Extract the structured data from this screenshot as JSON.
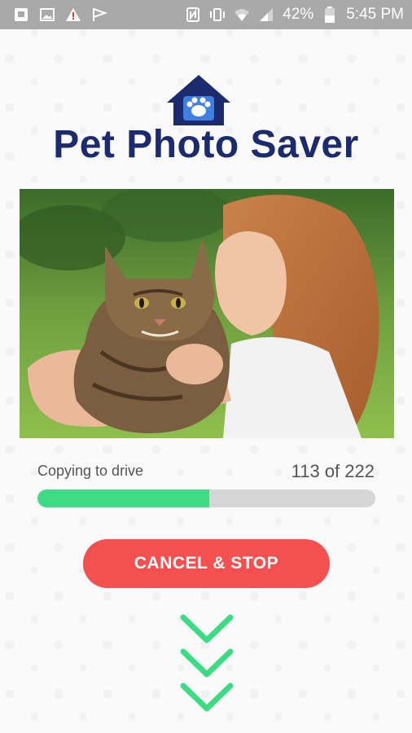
{
  "status_bar": {
    "battery": "42%",
    "time": "5:45 PM",
    "left_icons": [
      "photo-icon",
      "image-icon",
      "alert-icon",
      "flag-icon"
    ],
    "right_icons": [
      "nfc-icon",
      "vibrate-icon",
      "wifi-icon",
      "signal-icon",
      "battery-icon"
    ]
  },
  "app": {
    "title": "Pet Photo Saver",
    "logo_icon": "house-paw-icon",
    "brand_color": "#1c2a6e"
  },
  "photo": {
    "subject": "woman kissing tabby cat"
  },
  "progress": {
    "label": "Copying to drive",
    "count_text": "113 of 222",
    "current": 113,
    "total": 222,
    "fill_color": "#3ddc84"
  },
  "cancel_button": {
    "label": "CANCEL & STOP",
    "color": "#f4504f"
  },
  "scroll_hint": {
    "icon": "chevron-down-icon",
    "count": 3,
    "color": "#3ddc84"
  }
}
